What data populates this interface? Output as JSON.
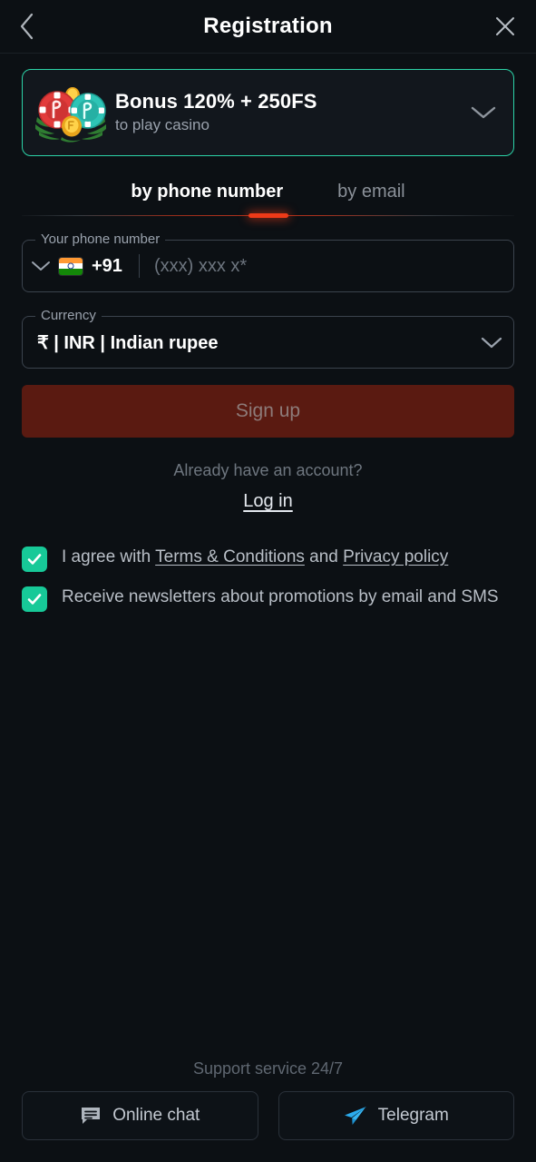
{
  "theme": {
    "bg": "#0c1014",
    "accent_green": "#2cd3a7",
    "checkbox_green": "#17c998",
    "tab_indicator_red": "#ee3a18",
    "signup_disabled_bg": "#5a1a11",
    "signup_disabled_text": "#8d7b79",
    "telegram_blue": "#2aabee"
  },
  "header": {
    "title": "Registration",
    "back_icon": "chevron-left-icon",
    "close_icon": "close-icon"
  },
  "bonus_banner": {
    "title": "Bonus 120% + 250FS",
    "subtitle": "to play casino",
    "art_icon": "casino-chips-icon",
    "expand_icon": "chevron-down-icon"
  },
  "tabs": [
    {
      "label": "by phone number",
      "active": true
    },
    {
      "label": "by email",
      "active": false
    }
  ],
  "phone_field": {
    "label": "Your phone number",
    "country_dropdown_icon": "chevron-down-icon",
    "flag_icon": "flag-india-icon",
    "dial_code": "+91",
    "value": "",
    "placeholder": "(xxx) xxx x*"
  },
  "currency_field": {
    "label": "Currency",
    "value": "₹ | INR | Indian rupee",
    "dropdown_icon": "chevron-down-icon"
  },
  "signup": {
    "label": "Sign up",
    "enabled": false
  },
  "login": {
    "prompt": "Already have an account?",
    "link_label": "Log in"
  },
  "agreements": [
    {
      "checked": true,
      "prefix": "I agree with ",
      "link1": "Terms & Conditions",
      "middle": " and ",
      "link2": "Privacy policy",
      "suffix": ""
    },
    {
      "checked": true,
      "prefix": "Receive newsletters about promotions by email and SMS",
      "link1": "",
      "middle": "",
      "link2": "",
      "suffix": ""
    }
  ],
  "footer": {
    "support_label": "Support service 24/7",
    "buttons": [
      {
        "label": "Online chat",
        "icon": "chat-bubble-icon"
      },
      {
        "label": "Telegram",
        "icon": "telegram-plane-icon"
      }
    ]
  }
}
